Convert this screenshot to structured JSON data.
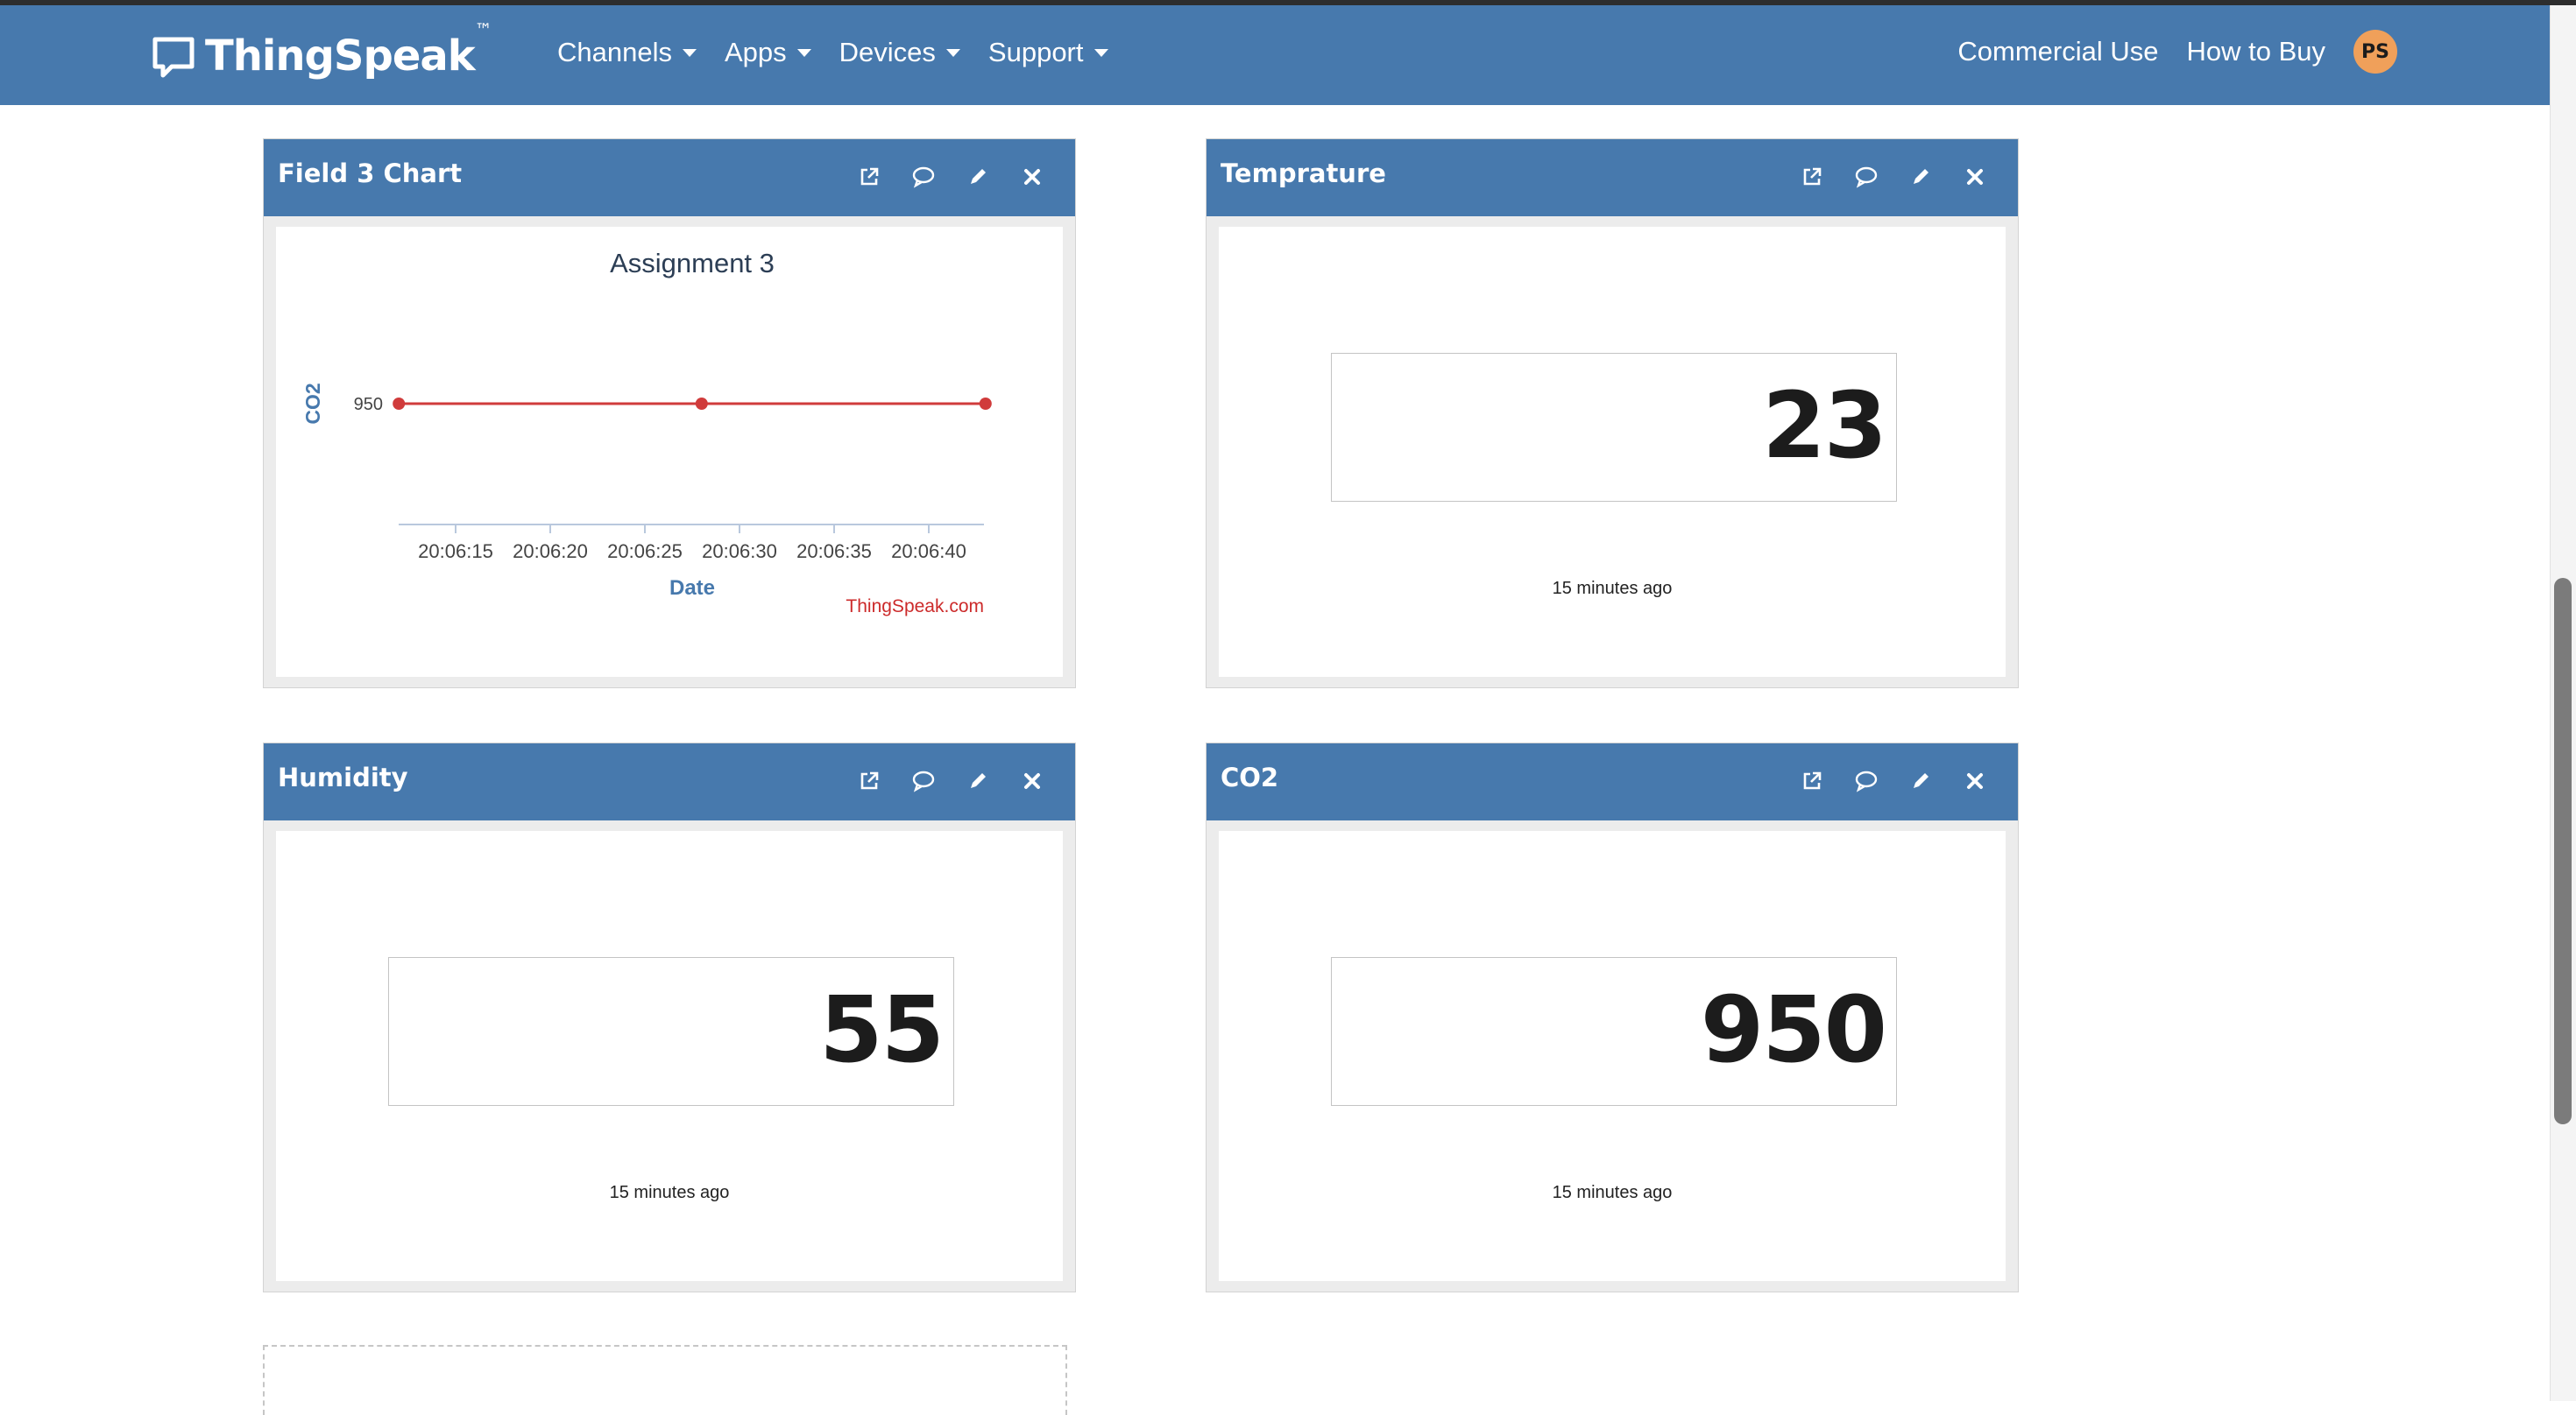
{
  "navbar": {
    "brand": "ThingSpeak",
    "brand_tm": "™",
    "menu": [
      {
        "label": "Channels"
      },
      {
        "label": "Apps"
      },
      {
        "label": "Devices"
      },
      {
        "label": "Support"
      }
    ],
    "right_links": [
      {
        "label": "Commercial Use"
      },
      {
        "label": "How to Buy"
      }
    ],
    "avatar_initials": "PS",
    "colors": {
      "navbar": "#4779ad",
      "avatar": "#f0a05a"
    }
  },
  "widgets": [
    {
      "title": "Field 3 Chart",
      "type": "chart"
    },
    {
      "title": "Temprature",
      "value": "23",
      "updated": "15 minutes ago"
    },
    {
      "title": "Humidity",
      "value": "55",
      "updated": "15 minutes ago"
    },
    {
      "title": "CO2",
      "value": "950",
      "updated": "15 minutes ago"
    }
  ],
  "widget_tools": [
    "external-link-icon",
    "comment-icon",
    "pencil-icon",
    "close-icon"
  ],
  "chart_data": {
    "type": "line",
    "title": "Assignment 3",
    "xlabel": "Date",
    "ylabel": "CO2",
    "credit": "ThingSpeak.com",
    "x_ticks": [
      "20:06:15",
      "20:06:20",
      "20:06:25",
      "20:06:30",
      "20:06:35",
      "20:06:40"
    ],
    "y_ticks": [
      "950"
    ],
    "series": [
      {
        "color": "#d03b3b",
        "x": [
          "20:06:12",
          "20:06:28",
          "20:06:43"
        ],
        "values": [
          950,
          950,
          950
        ]
      }
    ],
    "grid": false
  }
}
